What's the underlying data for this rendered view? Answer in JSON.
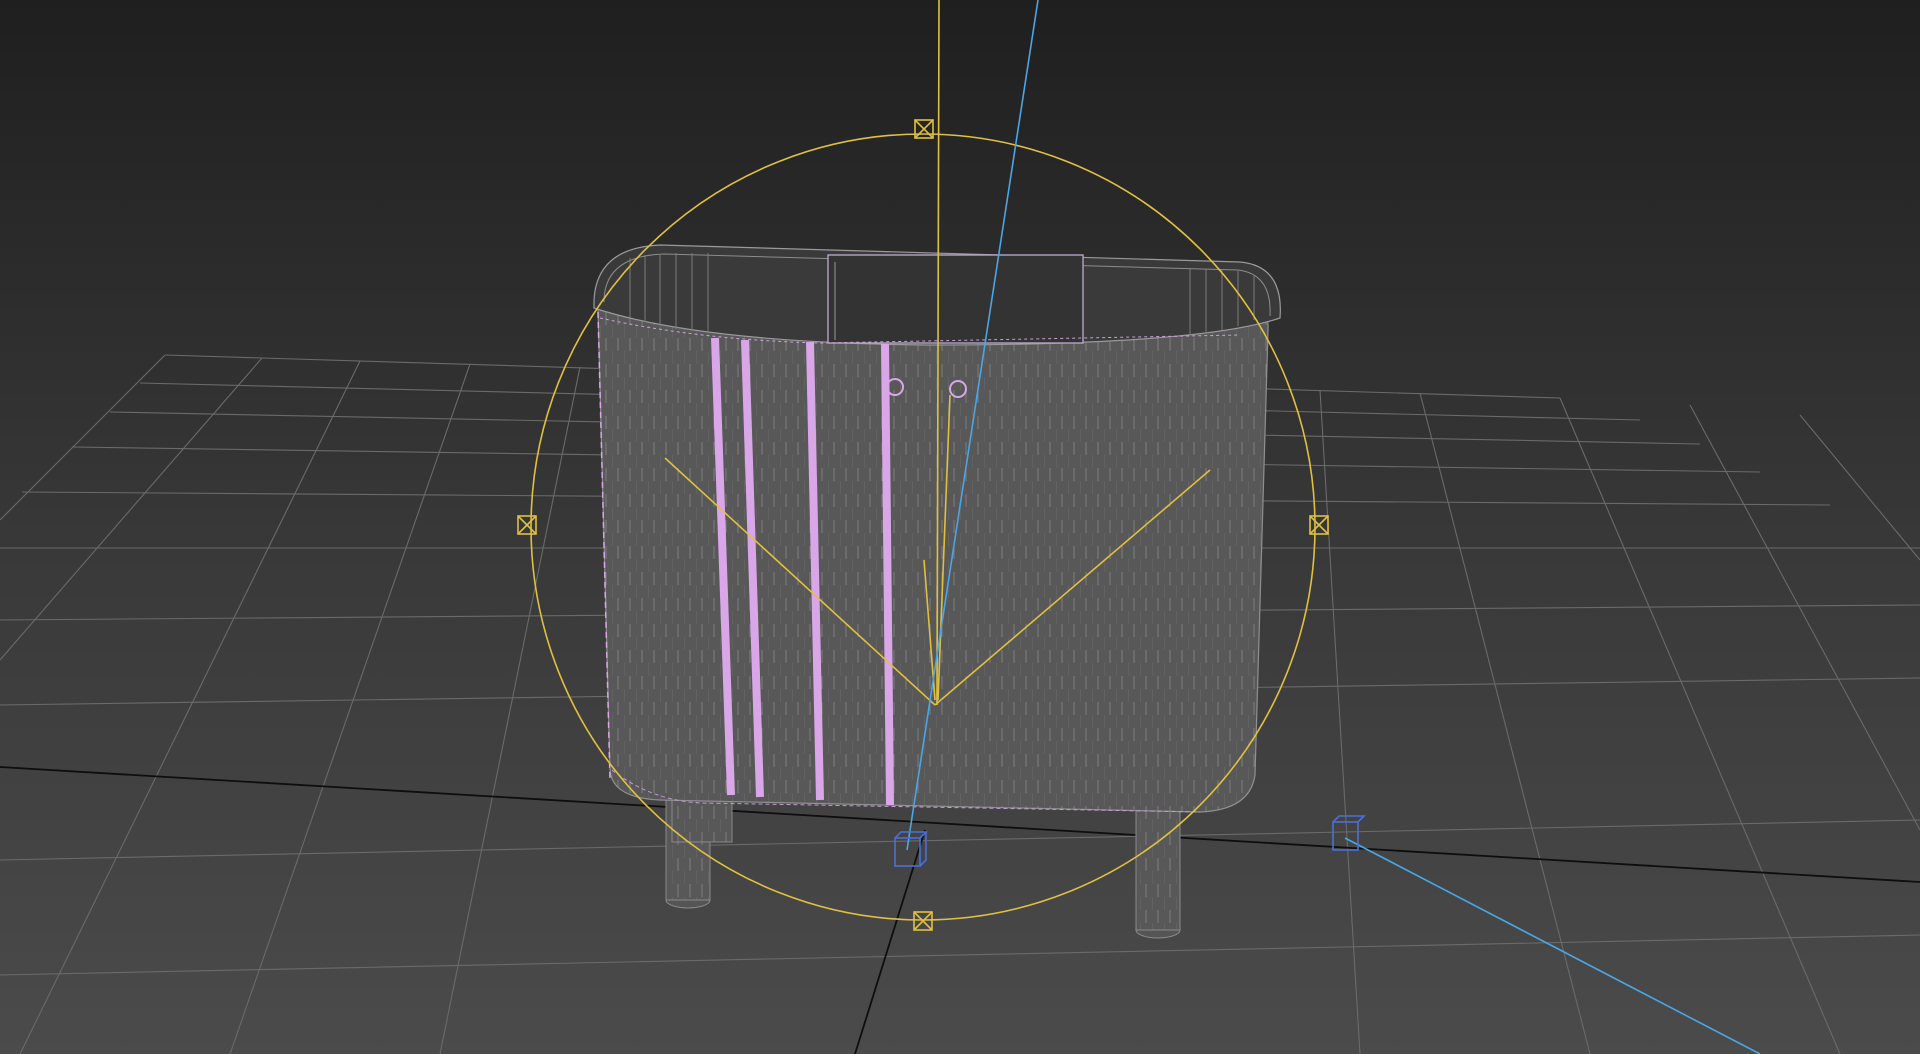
{
  "viewport": {
    "background_top": "#1f1f1f",
    "background_bottom": "#4a4a4a"
  },
  "colors": {
    "grid": "#6a6a6a",
    "grid_axis": "#101010",
    "wireframe": "#8a8a8a",
    "mesh_fill": "#5b5b5b",
    "selected_edges": "#d9a6e8",
    "light_gizmo": "#e0c040",
    "target_line": "#4aa6e6",
    "target_box": "#4a70d8"
  },
  "icons": {
    "gizmo_handle": "square-x-icon",
    "light_target": "cube-icon"
  }
}
